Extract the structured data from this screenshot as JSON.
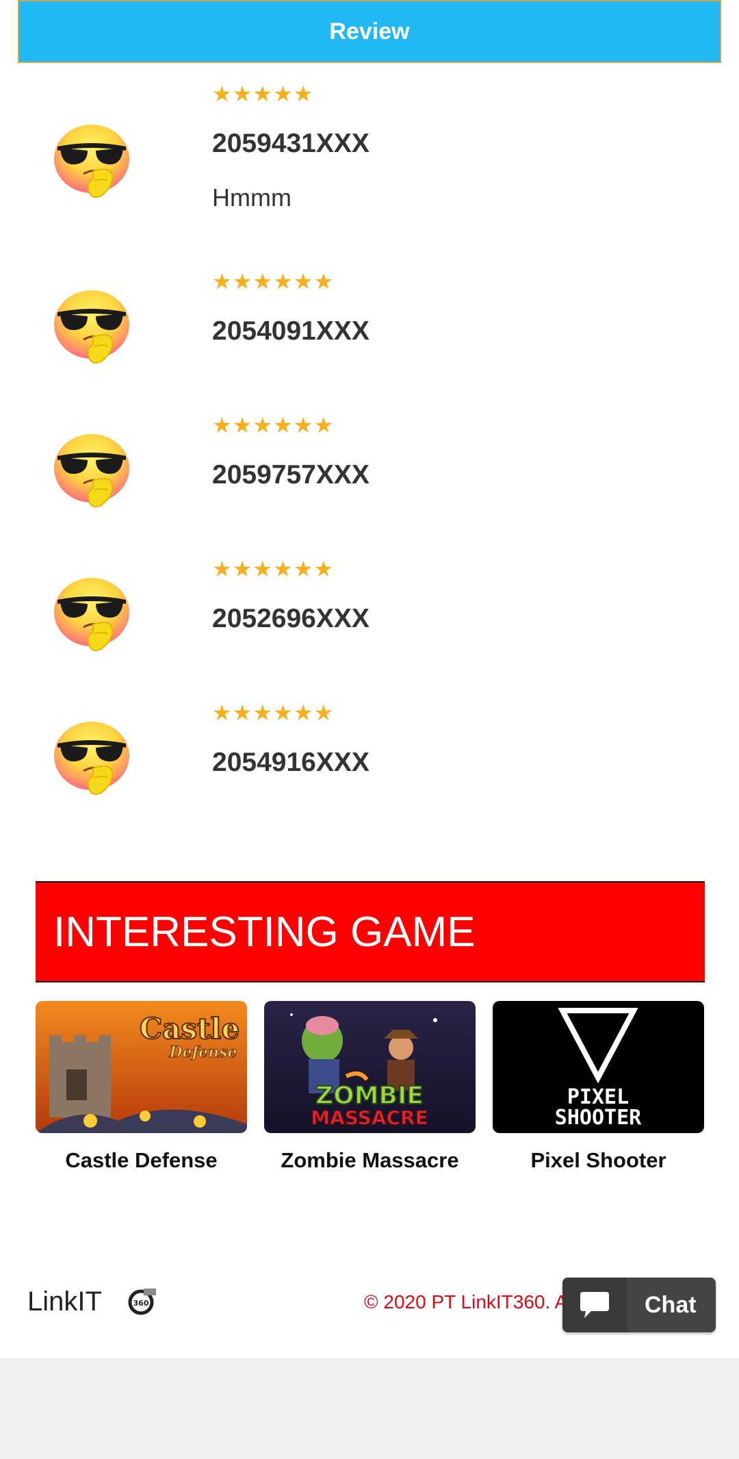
{
  "header": {
    "review_label": "Review"
  },
  "reviews": [
    {
      "stars_text": "★★★★★",
      "rating": 5,
      "phone": "2059431XXX",
      "comment": "Hmmm"
    },
    {
      "stars_text": "★★★★★★",
      "rating": 6,
      "phone": "2054091XXX",
      "comment": ""
    },
    {
      "stars_text": "★★★★★★",
      "rating": 6,
      "phone": "2059757XXX",
      "comment": ""
    },
    {
      "stars_text": "★★★★★★",
      "rating": 6,
      "phone": "2052696XXX",
      "comment": ""
    },
    {
      "stars_text": "★★★★★★",
      "rating": 6,
      "phone": "2054916XXX",
      "comment": ""
    }
  ],
  "games_section": {
    "heading": "INTERESTING GAME",
    "games": [
      {
        "title": "Castle Defense",
        "thumb_line1": "Castle",
        "thumb_line2": "Defense"
      },
      {
        "title": "Zombie Massacre",
        "thumb_line1": "ZOMBIE",
        "thumb_line2": "MASSACRE"
      },
      {
        "title": "Pixel Shooter",
        "thumb_line1": "PIXEL",
        "thumb_line2": "SHOOTER"
      }
    ]
  },
  "footer": {
    "logo_text": "LinkIT",
    "logo_badge": "360",
    "copyright": "© 2020 PT LinkIT360. All rights reserved."
  },
  "chat": {
    "label": "Chat"
  },
  "colors": {
    "review_bar": "#22b8f6",
    "star": "#f6b01e",
    "banner": "#ff0000",
    "copyright": "#e30613",
    "chat_bg": "#444444",
    "page_bottom": "#efefef"
  },
  "icons": [
    "thinking-cool-emoji-icon",
    "star-icon",
    "chat-bubble-icon"
  ]
}
